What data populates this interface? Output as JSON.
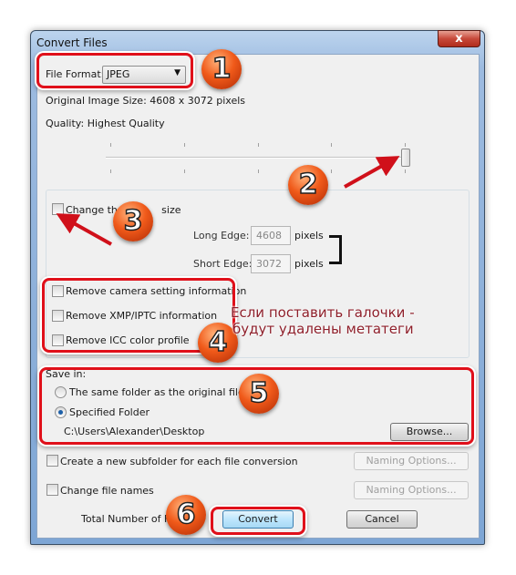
{
  "window": {
    "title": "Convert Files",
    "close_icon": "close-icon"
  },
  "file_format": {
    "label": "File Format:",
    "value": "JPEG"
  },
  "original_size": "Original Image Size: 4608 x 3072 pixels",
  "quality": {
    "label": "Quality: Highest Quality",
    "slider_percent": 100
  },
  "resize": {
    "checkbox_label_left": "Change the",
    "checkbox_label_right": "size",
    "checked": false,
    "long_edge": {
      "label": "Long Edge:",
      "value": "4608",
      "unit": "pixels"
    },
    "short_edge": {
      "label": "Short Edge:",
      "value": "3072",
      "unit": "pixels"
    }
  },
  "metadata": [
    {
      "label": "Remove camera setting information",
      "checked": false
    },
    {
      "label": "Remove XMP/IPTC information",
      "checked": false
    },
    {
      "label": "Remove ICC color profile",
      "checked": false
    }
  ],
  "annotation_text": [
    "Если поставить галочки -",
    "будут удалены метатеги"
  ],
  "save_in": {
    "label": "Save in:",
    "options": [
      {
        "label": "The same folder as the original file",
        "selected": false
      },
      {
        "label": "Specified Folder",
        "selected": true
      }
    ],
    "path": "C:\\Users\\Alexander\\Desktop",
    "browse": "Browse..."
  },
  "subfolder": {
    "label": "Create a new subfolder for each file conversion",
    "checked": false,
    "button": "Naming Options..."
  },
  "change_names": {
    "label": "Change file names",
    "checked": false,
    "button": "Naming Options..."
  },
  "total_label": "Total Number of File",
  "convert": "Convert",
  "cancel": "Cancel",
  "steps": [
    "1",
    "2",
    "3",
    "4",
    "5",
    "6"
  ],
  "colors": {
    "annotation_red": "#e0101a",
    "badge_orange": "#f05a1a",
    "annotation_text": "#8e1f2a"
  }
}
